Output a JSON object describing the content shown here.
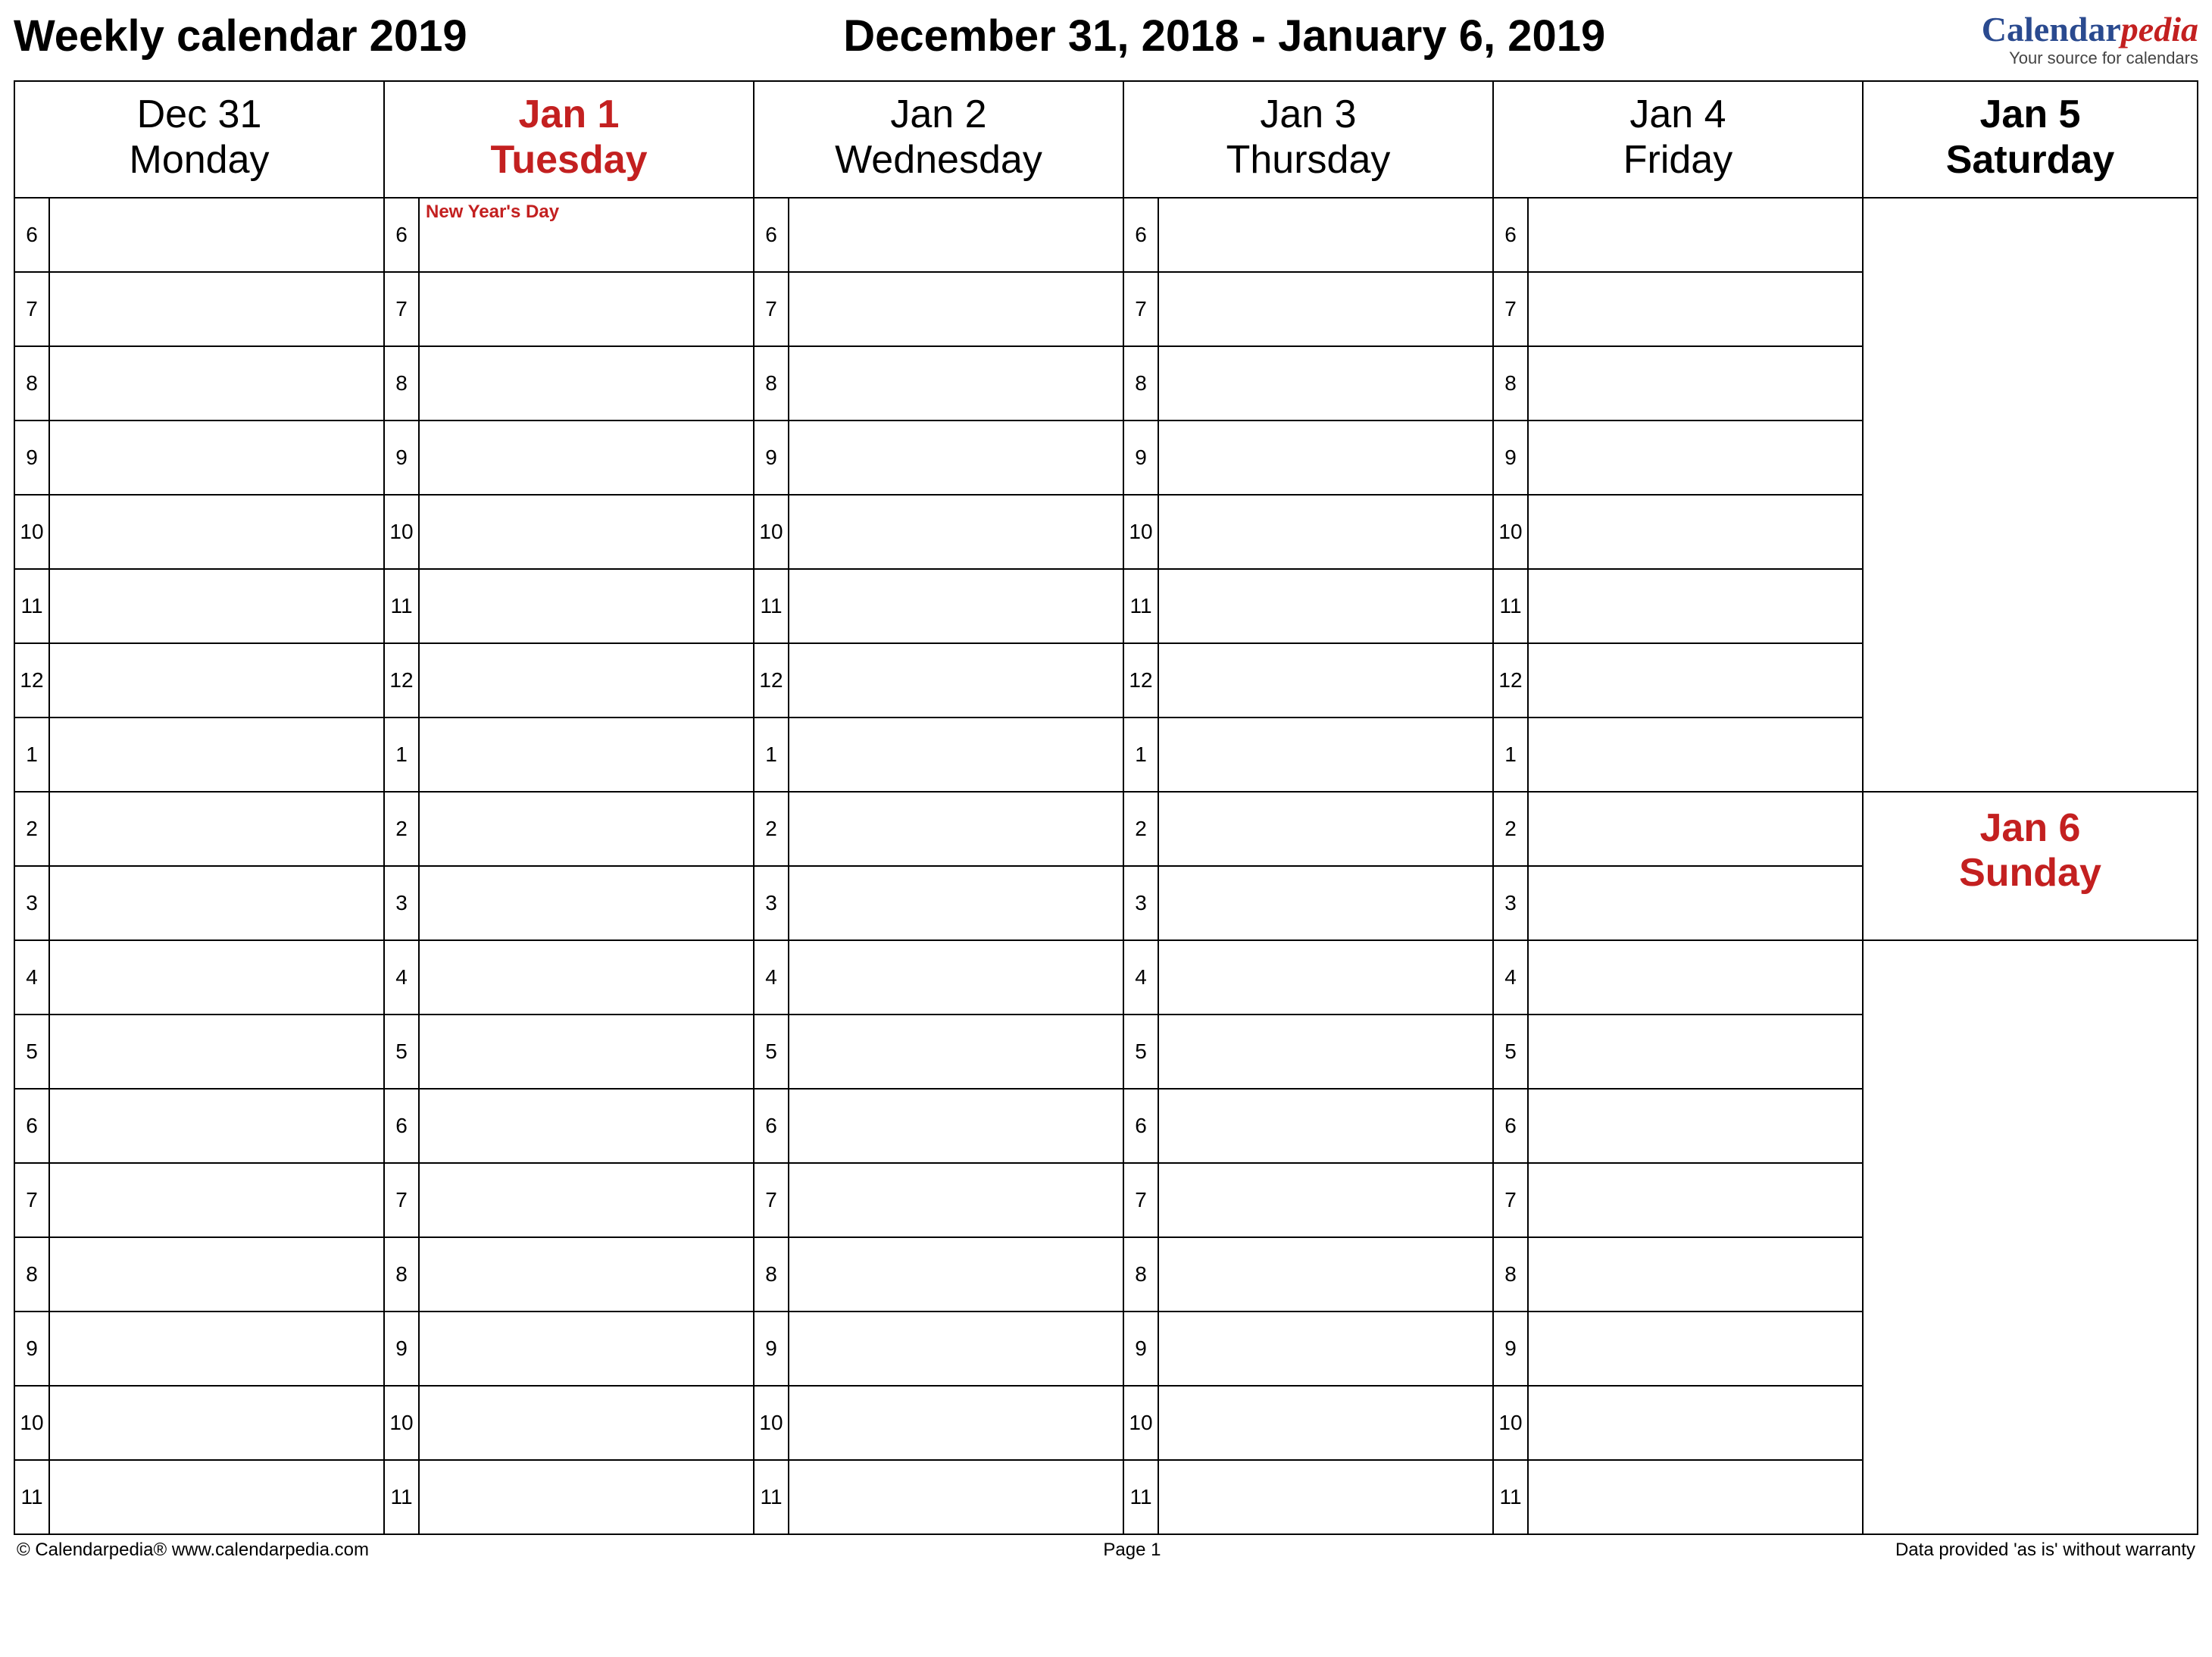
{
  "header": {
    "title_left": "Weekly calendar 2019",
    "title_center": "December 31, 2018 - January 6, 2019",
    "brand_main": "Calendar",
    "brand_accent": "pedia",
    "brand_tagline": "Your source for calendars"
  },
  "days": [
    {
      "date": "Dec 31",
      "dow": "Monday",
      "holiday": "",
      "is_holiday": false
    },
    {
      "date": "Jan 1",
      "dow": "Tuesday",
      "holiday": "New Year's Day",
      "is_holiday": true
    },
    {
      "date": "Jan 2",
      "dow": "Wednesday",
      "holiday": "",
      "is_holiday": false
    },
    {
      "date": "Jan 3",
      "dow": "Thursday",
      "holiday": "",
      "is_holiday": false
    },
    {
      "date": "Jan 4",
      "dow": "Friday",
      "holiday": "",
      "is_holiday": false
    }
  ],
  "weekend": {
    "sat": {
      "date": "Jan 5",
      "dow": "Saturday"
    },
    "sun": {
      "date": "Jan 6",
      "dow": "Sunday"
    }
  },
  "hours": [
    "6",
    "7",
    "8",
    "9",
    "10",
    "11",
    "12",
    "1",
    "2",
    "3",
    "4",
    "5",
    "6",
    "7",
    "8",
    "9",
    "10",
    "11"
  ],
  "footer": {
    "left": "© Calendarpedia®   www.calendarpedia.com",
    "center": "Page 1",
    "right": "Data provided 'as is' without warranty"
  }
}
